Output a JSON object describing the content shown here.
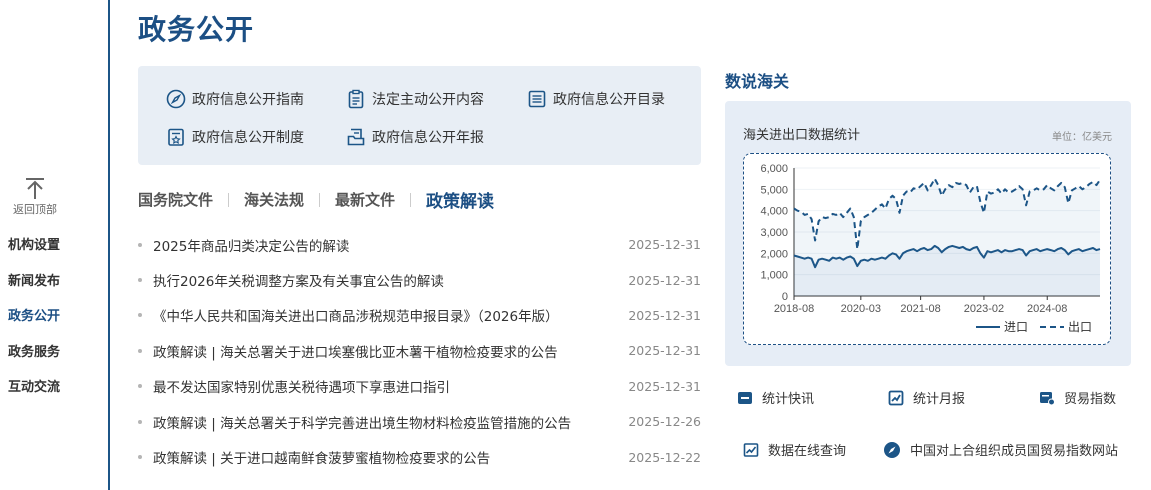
{
  "rail": {
    "back_to_top": "返回顶部",
    "items": [
      "机构设置",
      "新闻发布",
      "政务公开",
      "政务服务",
      "互动交流"
    ],
    "active_index": 2
  },
  "page_title": "政务公开",
  "quick_links": [
    {
      "label": "政府信息公开指南",
      "icon": "compass-icon"
    },
    {
      "label": "法定主动公开内容",
      "icon": "clipboard-icon"
    },
    {
      "label": "政府信息公开目录",
      "icon": "list-icon"
    },
    {
      "label": "政府信息公开制度",
      "icon": "policy-doc-icon"
    },
    {
      "label": "政府信息公开年报",
      "icon": "annual-report-icon"
    }
  ],
  "tabs": [
    "国务院文件",
    "海关法规",
    "最新文件",
    "政策解读"
  ],
  "active_tab": 3,
  "news": [
    {
      "title": "2025年商品归类决定公告的解读",
      "date": "2025-12-31"
    },
    {
      "title": "执行2026年关税调整方案及有关事宜公告的解读",
      "date": "2025-12-31"
    },
    {
      "title": "《中华人民共和国海关进出口商品涉税规范申报目录》（2026年版）",
      "date": "2025-12-31"
    },
    {
      "title": "政策解读 | 海关总署关于进口埃塞俄比亚木薯干植物检疫要求的公告",
      "date": "2025-12-31"
    },
    {
      "title": "最不发达国家特别优惠关税待遇项下享惠进口指引",
      "date": "2025-12-31"
    },
    {
      "title": "政策解读 | 海关总署关于科学完善进出境生物材料检疫监管措施的公告",
      "date": "2025-12-26"
    },
    {
      "title": "政策解读 | 关于进口越南鲜食菠萝蜜植物检疫要求的公告",
      "date": "2025-12-22"
    }
  ],
  "customs": {
    "section_title": "数说海关",
    "chart_title": "海关进出口数据统计",
    "unit": "单位：亿美元",
    "services": [
      {
        "label": "统计快讯",
        "icon": "stat-news-icon"
      },
      {
        "label": "统计月报",
        "icon": "monthly-report-icon"
      },
      {
        "label": "贸易指数",
        "icon": "trade-index-icon"
      },
      {
        "label": "数据在线查询",
        "icon": "data-query-icon"
      },
      {
        "label": "中国对上合组织成员国贸易指数网站",
        "icon": "compass-icon"
      }
    ]
  },
  "chart_data": {
    "type": "line",
    "ylim": [
      0,
      6000
    ],
    "yticks": [
      "0",
      "1,000",
      "2,000",
      "3,000",
      "4,000",
      "5,000",
      "6,000"
    ],
    "xticks": [
      "2018-08",
      "2020-03",
      "2021-08",
      "2023-02",
      "2024-08"
    ],
    "x": [
      "2018-08",
      "2018-09",
      "2018-10",
      "2018-11",
      "2018-12",
      "2019-01",
      "2019-02",
      "2019-03",
      "2019-04",
      "2019-05",
      "2019-06",
      "2019-07",
      "2019-08",
      "2019-09",
      "2019-10",
      "2019-11",
      "2019-12",
      "2020-01",
      "2020-02",
      "2020-03",
      "2020-04",
      "2020-05",
      "2020-06",
      "2020-07",
      "2020-08",
      "2020-09",
      "2020-10",
      "2020-11",
      "2020-12",
      "2021-01",
      "2021-02",
      "2021-03",
      "2021-04",
      "2021-05",
      "2021-06",
      "2021-07",
      "2021-08",
      "2021-09",
      "2021-10",
      "2021-11",
      "2021-12",
      "2022-01",
      "2022-02",
      "2022-03",
      "2022-04",
      "2022-05",
      "2022-06",
      "2022-07",
      "2022-08",
      "2022-09",
      "2022-10",
      "2022-11",
      "2022-12",
      "2023-01",
      "2023-02",
      "2023-03",
      "2023-04",
      "2023-05",
      "2023-06",
      "2023-07",
      "2023-08",
      "2023-09",
      "2023-10",
      "2023-11",
      "2023-12",
      "2024-01",
      "2024-02",
      "2024-03",
      "2024-04",
      "2024-05",
      "2024-06",
      "2024-07",
      "2024-08",
      "2024-09",
      "2024-10",
      "2024-11",
      "2024-12",
      "2025-01",
      "2025-02",
      "2025-03",
      "2025-04",
      "2025-05",
      "2025-06",
      "2025-07",
      "2025-08",
      "2025-09",
      "2025-10",
      "2025-11"
    ],
    "series": [
      {
        "name": "进口",
        "style": "solid",
        "color": "#1c5587",
        "values": [
          1900,
          1850,
          1800,
          1750,
          1800,
          1750,
          1350,
          1700,
          1750,
          1700,
          1650,
          1800,
          1750,
          1800,
          1700,
          1800,
          1850,
          1750,
          1400,
          1650,
          1700,
          1650,
          1750,
          1700,
          1750,
          1800,
          1750,
          1900,
          2000,
          1950,
          1750,
          2000,
          2100,
          2150,
          2200,
          2100,
          2200,
          2250,
          2150,
          2200,
          2350,
          2250,
          2050,
          2200,
          2300,
          2350,
          2300,
          2250,
          2300,
          2200,
          2150,
          2250,
          2300,
          2000,
          1800,
          2100,
          2050,
          2100,
          2150,
          2050,
          2150,
          2100,
          2100,
          2150,
          2200,
          2150,
          1900,
          2100,
          2150,
          2200,
          2100,
          2150,
          2200,
          2150,
          2100,
          2200,
          2250,
          2150,
          1950,
          2100,
          2150,
          2200,
          2100,
          2150,
          2200,
          2250,
          2150,
          2200
        ]
      },
      {
        "name": "出口",
        "style": "dashed",
        "color": "#1c5587",
        "values": [
          4100,
          4000,
          3950,
          3800,
          3850,
          3600,
          2600,
          3500,
          3700,
          3650,
          3700,
          3850,
          3800,
          3900,
          3700,
          3900,
          4100,
          3700,
          2200,
          3500,
          3700,
          3800,
          3900,
          4050,
          4200,
          4300,
          4100,
          4550,
          4700,
          4550,
          3900,
          4700,
          4900,
          4850,
          5050,
          5000,
          5150,
          5300,
          4950,
          5200,
          5500,
          5200,
          4700,
          5000,
          5200,
          5100,
          5300,
          5250,
          5300,
          5200,
          4850,
          5100,
          5150,
          4400,
          3900,
          4900,
          4800,
          4850,
          5000,
          4800,
          5000,
          4850,
          4900,
          5000,
          5150,
          5000,
          4250,
          4900,
          4950,
          5050,
          4950,
          5000,
          5200,
          5050,
          4950,
          5150,
          5300,
          5100,
          4350,
          4950,
          5050,
          5150,
          5000,
          5100,
          5250,
          5350,
          5200,
          5450
        ]
      }
    ],
    "legend": "bottom-right",
    "area_fill": true
  }
}
